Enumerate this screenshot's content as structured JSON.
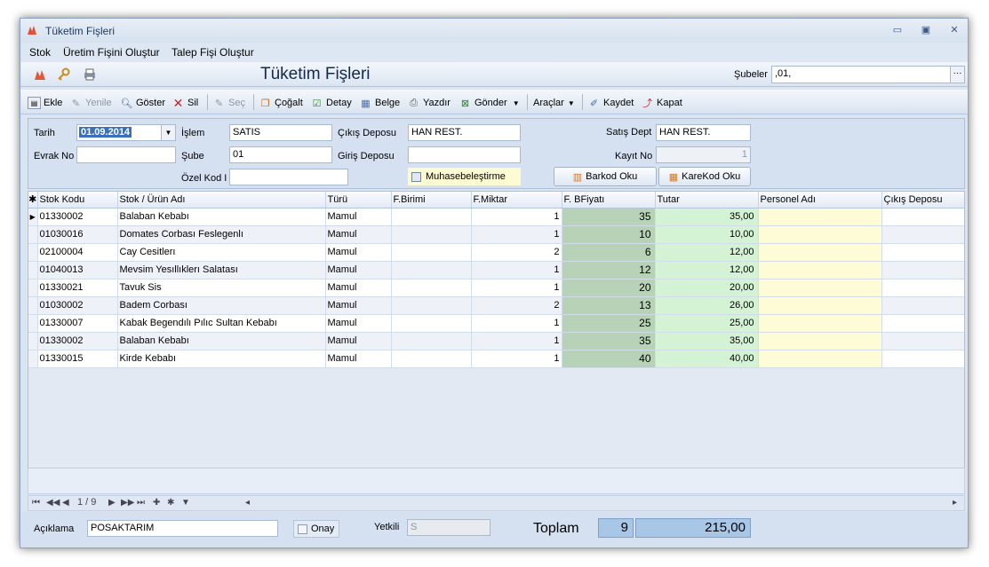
{
  "window": {
    "title": "Tüketim Fişleri"
  },
  "menu": [
    "Stok",
    "Üretim Fişini Oluştur",
    "Talep Fişi Oluştur"
  ],
  "header": {
    "title": "Tüketim Fişleri",
    "subeler_label": "Şubeler",
    "subeler_value": ",01,",
    "ellipsis": "···"
  },
  "toolbar": {
    "ekle": "Ekle",
    "yenile": "Yenile",
    "goster": "Göster",
    "sil": "Sil",
    "sec": "Seç",
    "cogalt": "Çoğalt",
    "detay": "Detay",
    "belge": "Belge",
    "yazdir": "Yazdır",
    "gonder": "Gönder",
    "araclar": "Araçlar",
    "kaydet": "Kaydet",
    "kapat": "Kapat"
  },
  "form": {
    "tarih_label": "Tarih",
    "tarih_value": "01.09.2014",
    "evrak_label": "Evrak No",
    "evrak_value": "",
    "islem_label": "İşlem",
    "islem_value": "SATIS",
    "sube_label": "Şube",
    "sube_value": "01",
    "ozel_label": "Özel Kod I",
    "ozel_value": "",
    "cikis_label": "Çıkış Deposu",
    "cikis_value": "HAN REST.",
    "giris_label": "Giriş Deposu",
    "giris_value": "",
    "muhasebe_label": "Muhasebeleştirme",
    "satis_label": "Satış Dept",
    "satis_value": "HAN REST.",
    "kayit_label": "Kayıt No",
    "kayit_value": "1",
    "barkod_label": "Barkod Oku",
    "karekod_label": "KareKod Oku"
  },
  "table": {
    "columns": [
      "Stok Kodu",
      "Stok / Ürün Adı",
      "Türü",
      "F.Birimi",
      "F.Miktar",
      "F. BFiyatı",
      "Tutar",
      "Personel Adı",
      "Çıkış Deposu"
    ],
    "rows": [
      {
        "kod": "01330002",
        "ad": "Balaban Kebabı",
        "tur": "Mamul",
        "birim": "",
        "miktar": "1",
        "fiyat": "35",
        "tutar": "35,00"
      },
      {
        "kod": "01030016",
        "ad": "Domates Corbası Feslegenlı",
        "tur": "Mamul",
        "birim": "",
        "miktar": "1",
        "fiyat": "10",
        "tutar": "10,00"
      },
      {
        "kod": "02100004",
        "ad": "Cay Cesitlerı",
        "tur": "Mamul",
        "birim": "",
        "miktar": "2",
        "fiyat": "6",
        "tutar": "12,00"
      },
      {
        "kod": "01040013",
        "ad": "Mevsim Yesıllıklerı Salatası",
        "tur": "Mamul",
        "birim": "",
        "miktar": "1",
        "fiyat": "12",
        "tutar": "12,00"
      },
      {
        "kod": "01330021",
        "ad": "Tavuk Sis",
        "tur": "Mamul",
        "birim": "",
        "miktar": "1",
        "fiyat": "20",
        "tutar": "20,00"
      },
      {
        "kod": "01030002",
        "ad": "Badem Corbası",
        "tur": "Mamul",
        "birim": "",
        "miktar": "2",
        "fiyat": "13",
        "tutar": "26,00"
      },
      {
        "kod": "01330007",
        "ad": "Kabak Begendılı Pılıc Sultan Kebabı",
        "tur": "Mamul",
        "birim": "",
        "miktar": "1",
        "fiyat": "25",
        "tutar": "25,00"
      },
      {
        "kod": "01330002",
        "ad": "Balaban Kebabı",
        "tur": "Mamul",
        "birim": "",
        "miktar": "1",
        "fiyat": "35",
        "tutar": "35,00"
      },
      {
        "kod": "01330015",
        "ad": "Kirde Kebabı",
        "tur": "Mamul",
        "birim": "",
        "miktar": "1",
        "fiyat": "40",
        "tutar": "40,00"
      }
    ]
  },
  "navigator": {
    "page": "1 / 9"
  },
  "footer": {
    "aciklama_label": "Açıklama",
    "aciklama_value": "POSAKTARIM",
    "onay_label": "Onay",
    "yetkili_label": "Yetkili",
    "yetkili_value": "S",
    "toplam_label": "Toplam",
    "toplam_count": "9",
    "toplam_value": "215,00"
  }
}
